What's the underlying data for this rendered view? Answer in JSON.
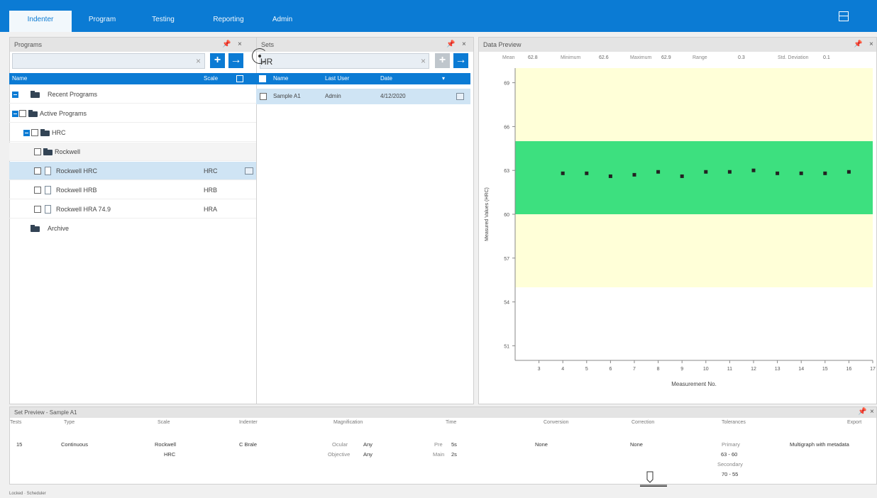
{
  "nav": {
    "tabs": [
      {
        "label": "Indenter"
      },
      {
        "label": "Program"
      },
      {
        "label": "Testing"
      },
      {
        "label": "Reporting"
      },
      {
        "label": "Admin"
      }
    ]
  },
  "programs_panel": {
    "title": "Programs",
    "columns": {
      "name": "Name",
      "scale": "Scale"
    },
    "tree": [
      {
        "label": "Recent Programs",
        "scale": ""
      },
      {
        "label": "Active Programs",
        "scale": ""
      },
      {
        "label": "HRC",
        "scale": ""
      },
      {
        "label": "Rockwell",
        "scale": ""
      },
      {
        "label": "Rockwell HRC",
        "scale": "HRC"
      },
      {
        "label": "Rockwell HRB",
        "scale": "HRB"
      },
      {
        "label": "Rockwell HRA 74.9",
        "scale": "HRA"
      },
      {
        "label": "Archive",
        "scale": ""
      }
    ]
  },
  "sets_panel": {
    "title": "Sets",
    "columns": {
      "name": "Name",
      "last_user": "Last User",
      "date": "Date"
    },
    "rows": [
      {
        "name": "Sample A1",
        "last_user": "Admin",
        "date": "4/12/2020"
      }
    ]
  },
  "data_preview": {
    "title": "Data Preview",
    "stats": [
      {
        "label": "Mean",
        "value": "62.8"
      },
      {
        "label": "Minimum",
        "value": "62.6"
      },
      {
        "label": "Maximum",
        "value": "62.9"
      },
      {
        "label": "Range",
        "value": "0.3"
      },
      {
        "label": "Std. Deviation",
        "value": "0.1"
      }
    ]
  },
  "chart_data": {
    "type": "scatter",
    "xlabel": "Measurement No.",
    "ylabel": "Measured Values (HRC)",
    "xlim": [
      2,
      17
    ],
    "ylim": [
      50,
      70
    ],
    "xticks": [
      3,
      4,
      5,
      6,
      7,
      8,
      9,
      10,
      11,
      12,
      13,
      14,
      15,
      16,
      17
    ],
    "yticks": [
      51,
      54,
      57,
      60,
      63,
      66,
      69
    ],
    "bands": [
      {
        "from": 55,
        "to": 71,
        "color": "#ffffd8"
      },
      {
        "from": 60,
        "to": 65,
        "color": "#3de07f"
      }
    ],
    "points": [
      {
        "x": 4,
        "y": 62.8
      },
      {
        "x": 5,
        "y": 62.8
      },
      {
        "x": 6,
        "y": 62.6
      },
      {
        "x": 7,
        "y": 62.7
      },
      {
        "x": 8,
        "y": 62.9
      },
      {
        "x": 9,
        "y": 62.6
      },
      {
        "x": 10,
        "y": 62.9
      },
      {
        "x": 11,
        "y": 62.9
      },
      {
        "x": 12,
        "y": 63.0
      },
      {
        "x": 13,
        "y": 62.8
      },
      {
        "x": 14,
        "y": 62.8
      },
      {
        "x": 15,
        "y": 62.8
      },
      {
        "x": 16,
        "y": 62.9
      }
    ],
    "grid": false
  },
  "preview_panel": {
    "title": "Set Preview - Sample A1",
    "columns": [
      "Tests",
      "Type",
      "Scale",
      "Indenter",
      "Magnification",
      "Time",
      "Conversion",
      "Correction",
      "Tolerances",
      "Export"
    ],
    "values": {
      "tests": "15",
      "type": "Continuous",
      "scale_1": "Rockwell",
      "scale_2": "HRC",
      "indenter": "C Brale",
      "indenter_symbol": "HR",
      "mag_label_1": "Ocular",
      "mag_value_1": "Any",
      "mag_label_2": "Objective",
      "mag_value_2": "Any",
      "time_label_1": "Pre",
      "time_value_1": "5s",
      "time_label_2": "Main",
      "time_value_2": "2s",
      "conversion": "None",
      "correction": "None",
      "tol_label_1": "Primary",
      "tol_value_1": "63 - 60",
      "tol_label_2": "Secondary",
      "tol_value_2": "70 - 55",
      "export": "Multigraph with metadata"
    }
  },
  "status_bar": {
    "text": "Locked · Scheduler"
  },
  "colors": {
    "accent": "#0b7bd4",
    "selected_row": "#cfe4f4",
    "tolerance_green": "#3de07f",
    "tolerance_yellow": "#ffffd8"
  }
}
